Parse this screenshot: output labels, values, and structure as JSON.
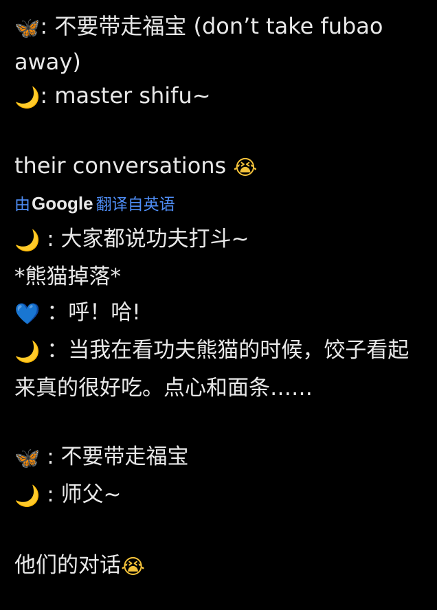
{
  "original": {
    "line1": {
      "emoji": "🦋",
      "text": ": 不要带走福宝 (don’t take fubao away)"
    },
    "line2": {
      "emoji": "🌙",
      "text": ": master shifu~"
    },
    "line3": {
      "text": "their conversations ",
      "emoji": "😭"
    }
  },
  "translation_bar": {
    "prefix": "由",
    "brand": "Google",
    "link": "翻译自英语"
  },
  "translated": {
    "line1": {
      "emoji": "🌙",
      "text": " : 大家都说功夫打斗~"
    },
    "line2": {
      "text": "*熊猫掉落*"
    },
    "line3": {
      "emoji": "💙",
      "text": " ：呼！哈!"
    },
    "line4": {
      "emoji": "🌙",
      "text": " ：当我在看功夫熊猫的时候，饺子看起来真的很好吃。点心和面条……"
    },
    "line5": {
      "emoji": "🦋",
      "text": " : 不要带走福宝"
    },
    "line6": {
      "emoji": "🌙",
      "text": " : 师父~"
    },
    "line7": {
      "text": "他们的对话",
      "emoji": "😭"
    }
  },
  "colors": {
    "background": "#000000",
    "text": "#e8e8e8",
    "link": "#4f8ef7"
  }
}
